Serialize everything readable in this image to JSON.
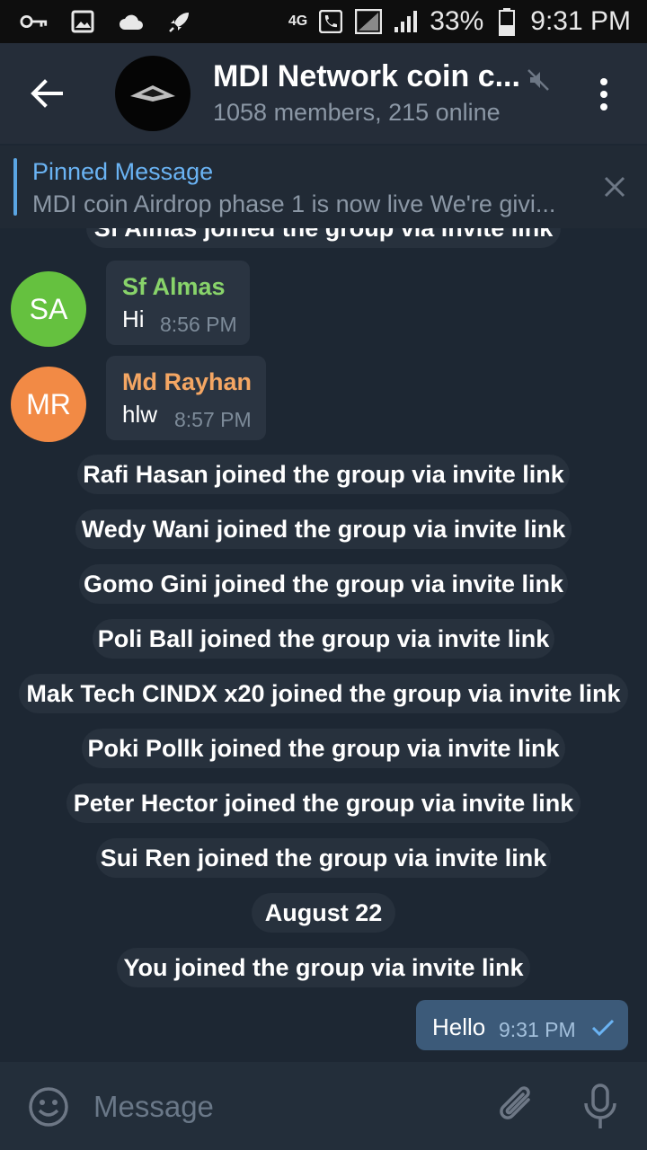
{
  "status_bar": {
    "network": "4G",
    "battery": "33%",
    "time": "9:31 PM",
    "icons": [
      "key-icon",
      "image-icon",
      "cloud-icon",
      "rocket-icon",
      "call-icon",
      "sim-signal-icon",
      "signal-icon",
      "battery-icon"
    ]
  },
  "header": {
    "title": "MDI Network coin c...",
    "subtitle": "1058 members, 215 online",
    "muted": true
  },
  "pinned": {
    "label": "Pinned Message",
    "text": "MDI coin Airdrop phase 1 is now live We're givi..."
  },
  "chat": {
    "partial_service": "Sf Almas joined the group via invite link",
    "messages": [
      {
        "initials": "SA",
        "name": "Sf Almas",
        "text": "Hi",
        "time": "8:56 PM",
        "avatar_color": "#65c13f",
        "name_color": "#88d36a"
      },
      {
        "initials": "MR",
        "name": "Md Rayhan",
        "text": "hlw",
        "time": "8:57 PM",
        "avatar_color": "#f28a45",
        "name_color": "#f4a663"
      }
    ],
    "service_messages": [
      "Rafi Hasan joined the group via invite link",
      "Wedy Wani joined the group via invite link",
      "Gomo Gini joined the group via invite link",
      "Poli Ball joined the group via invite link",
      "Mak Tech CINDX x20 joined the group via invite link",
      "Poki Pollk joined the group via invite link",
      "Peter Hector joined the group via invite link",
      "Sui Ren joined the group via invite link"
    ],
    "date_divider": "August 22",
    "you_joined": "You joined the group via invite link",
    "outgoing": {
      "text": "Hello",
      "time": "9:31 PM",
      "status": "sent"
    }
  },
  "input": {
    "placeholder": "Message"
  },
  "colors": {
    "background": "#1d2733",
    "header": "#252d39",
    "accent": "#6ab3f3",
    "outgoing_bubble": "#3c5a79"
  }
}
